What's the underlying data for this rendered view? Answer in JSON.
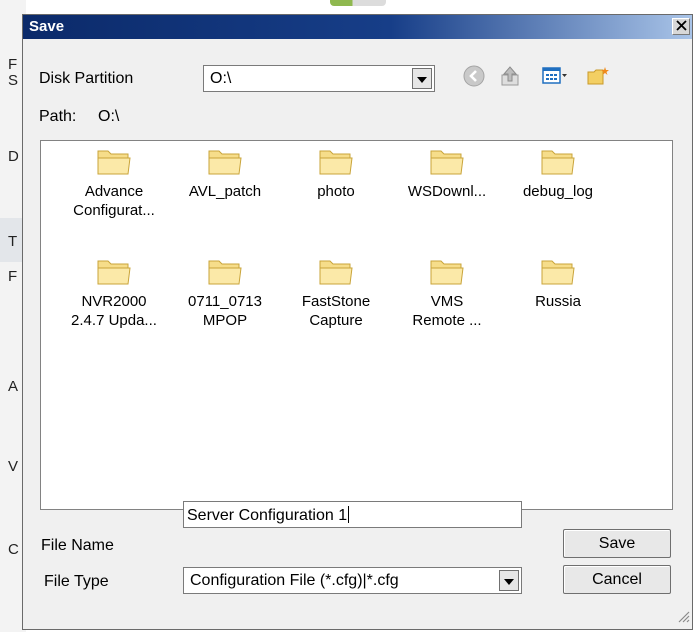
{
  "background": {
    "letters": [
      "F",
      "S",
      "D",
      "T",
      "F",
      "A",
      "V",
      "C"
    ]
  },
  "dialog": {
    "title": "Save",
    "close_label": "✕",
    "disk_partition_label": "Disk Partition",
    "disk_partition_value": "O:\\",
    "path_label": "Path:",
    "path_value": "O:\\",
    "toolbar_icons": [
      "back-icon",
      "up-folder-icon",
      "view-menu-icon",
      "new-folder-icon"
    ],
    "folders": [
      "Advance\nConfigurat...",
      "AVL_patch",
      "photo",
      "WSDownl...",
      "debug_log",
      "NVR2000\n2.4.7 Upda...",
      "0711_0713\nMPOP",
      "FastStone\nCapture",
      "VMS\nRemote ...",
      "Russia"
    ],
    "file_name_label": "File Name",
    "file_name_value": "Server Configuration 1",
    "file_type_label": "File Type",
    "file_type_value": "Configuration File (*.cfg)|*.cfg",
    "save_button": "Save",
    "cancel_button": "Cancel"
  },
  "colors": {
    "title_start": "#0b2a6a",
    "title_end": "#a9c4e8",
    "folder_fill": "#f6dd8a",
    "folder_stroke": "#c9a43a"
  }
}
